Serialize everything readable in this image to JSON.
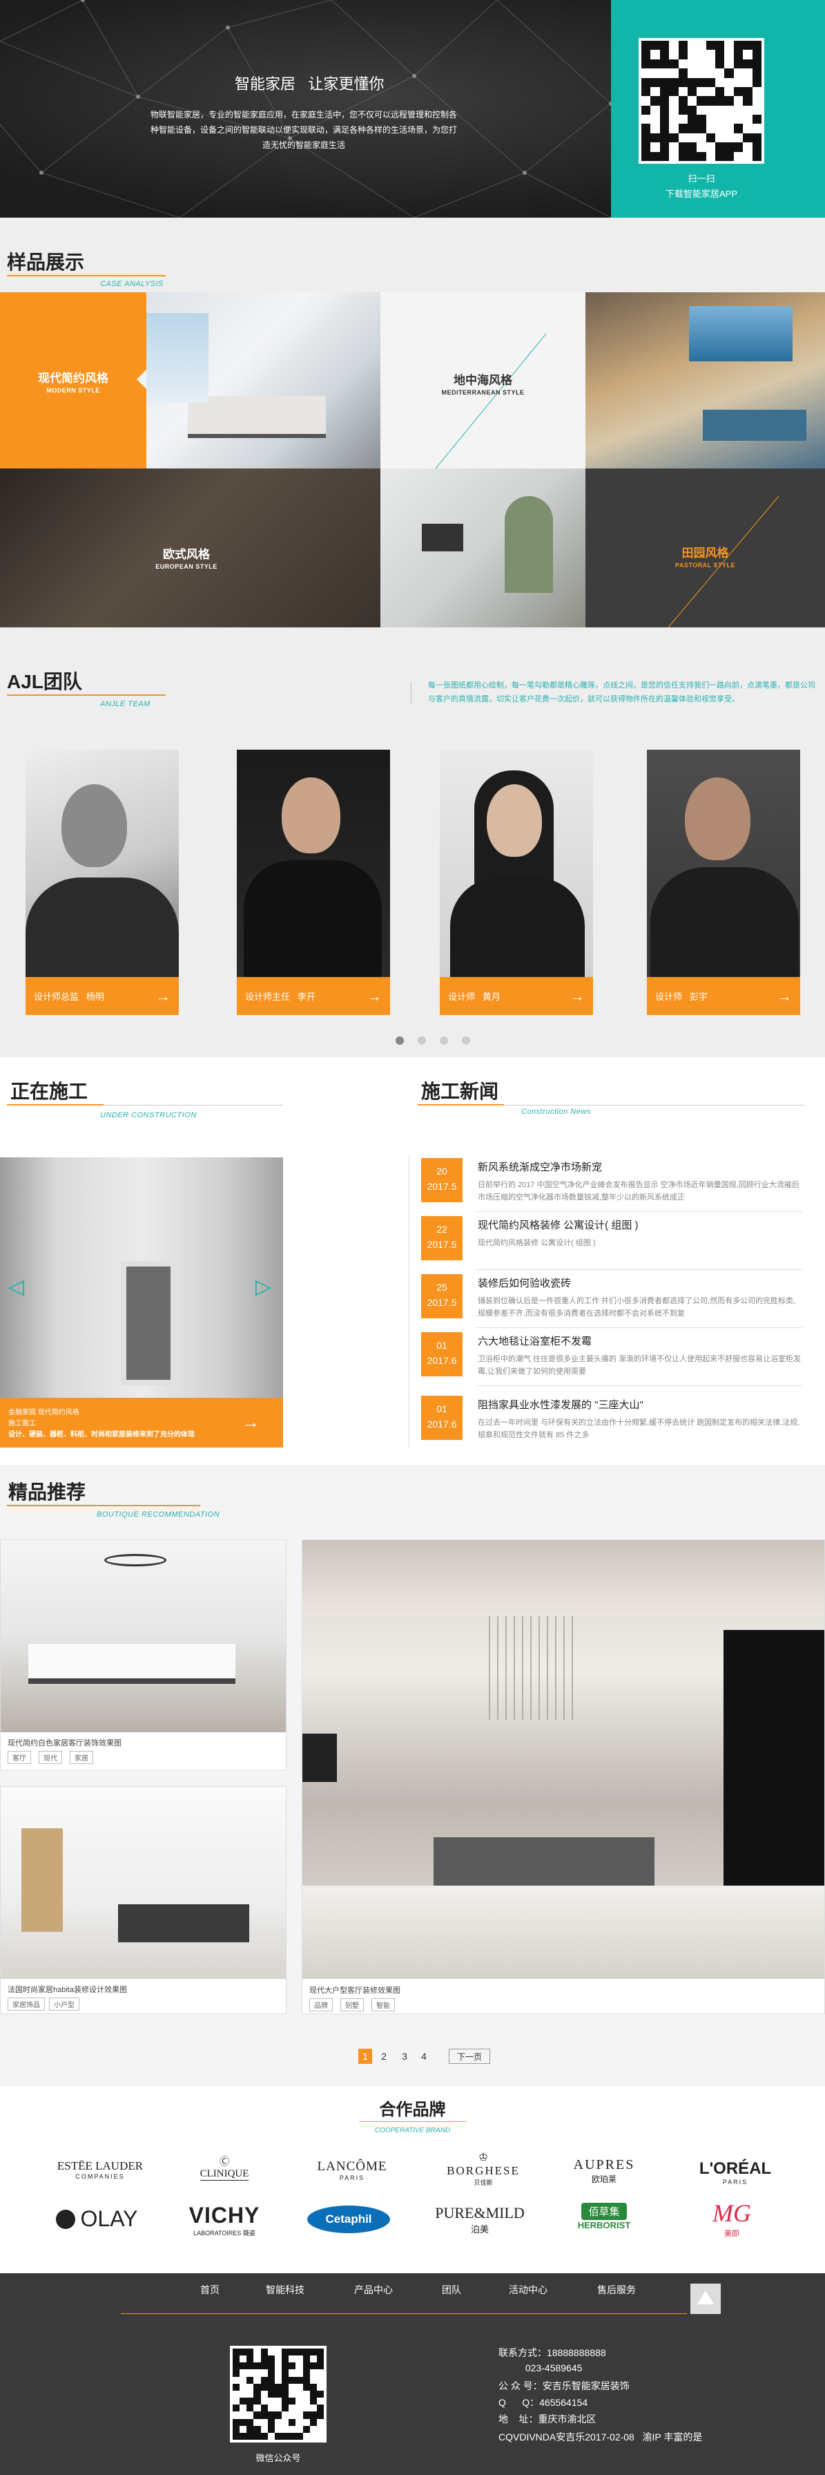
{
  "hero": {
    "title": "智能家居   让家更懂你",
    "desc": "物联智能家居，专业的智能家庭应用，在家庭生活中，您不仅可以远程管理和控制各种智能设备，设备之间的智能联动以便实现联动，满足各种各样的生活场景，为您打造无忧的智能家庭生活",
    "qr_caption1": "扫一扫",
    "qr_caption2": "下载智能家居APP"
  },
  "samples": {
    "title": "样品展示",
    "subtitle": "CASE ANALYSIS",
    "tiles": [
      {
        "cn": "现代简约风格",
        "en": "MODERN STYLE"
      },
      {
        "cn": "地中海风格",
        "en": "MEDITERRANEAN STYLE"
      },
      {
        "cn": "欧式风格",
        "en": "EUROPEAN STYLE"
      },
      {
        "cn": "田园风格",
        "en": "PASTORAL STYLE"
      }
    ]
  },
  "team": {
    "title": "AJL团队",
    "subtitle": "ANJLE TEAM",
    "intro": "每一张图纸都用心绘制，每一笔勾勒都是精心雕琢，点线之间，是您的信任支持我们一路向前，点滴笔墨，都是公司与客户的真情流露，切实让客户花费一次起价，就可以获得物件所在的温馨体验和视觉享受。",
    "members": [
      {
        "role": "设计师总监",
        "name": "杨明"
      },
      {
        "role": "设计师主任",
        "name": "李开"
      },
      {
        "role": "设计师",
        "name": "黄月"
      },
      {
        "role": "设计师",
        "name": "彭宇"
      }
    ]
  },
  "construction": {
    "title": "正在施工",
    "subtitle": "UNDER CONSTRUCTION",
    "caption1": "金融家园 现代简约风格",
    "caption2": "施工面工",
    "caption3": "设计、硬装、器柜、料柜、时尚和家居装修来到了充分的体现"
  },
  "news": {
    "title": "施工新闻",
    "subtitle": "Construction News",
    "items": [
      {
        "day": "20",
        "ym": "2017.5",
        "title": "新风系统渐成空净市场新宠",
        "desc": "日前举行的 2017 中国空气净化产业峰会发布报告显示 空净市场近年销量国规,回顾行业大流摧后 市场压缩的空气净化器市场数量锐减,整年少以的新风系统成正"
      },
      {
        "day": "22",
        "ym": "2017.5",
        "title": "现代简约风格装修 公寓设计( 组图 )",
        "desc": "现代简约风格装修 公寓设计( 组图 )"
      },
      {
        "day": "25",
        "ym": "2017.5",
        "title": "装修后如何验收瓷砖",
        "desc": "铺装到位确认后是一件很重人的工作 并们小很多消费者都选择了公司,然而有多公司的完胜标类,规模参差不齐,而没有很多消费者在选择时都不会对系统不到复"
      },
      {
        "day": "01",
        "ym": "2017.6",
        "title": "六大地毯让浴室柜不发霉",
        "desc": "卫浴柜中的潮气 往往是很多业主最头痛的 渐渐的环境不仅让人使用起来不舒服也容易让浴室柜发霉,让我们来做了如何的使用需要"
      },
      {
        "day": "01",
        "ym": "2017.6",
        "title": "阻挡家具业水性漆发展的 \"三座大山\"",
        "desc": "在过去一年时间里 与环保有关的立法由作十分频繁,缓不停去统计 跑国制定发布的相关法律,法规,规章和规范性文件就有 85 件之多"
      }
    ]
  },
  "boutique": {
    "title": "精品推荐",
    "subtitle": "BOUTIQUE RECOMMENDATION",
    "cards": [
      {
        "caption": "现代简约白色家居客厅装饰效果图",
        "tags": [
          "客厅",
          "现代",
          "家居"
        ]
      },
      {
        "caption": "法国时尚家居habita装修设计效果图",
        "tags": [
          "家居饰品",
          "小户型"
        ]
      },
      {
        "caption": "现代大户型客厅装修效果图",
        "tags": [
          "品牌",
          "别墅",
          "智能"
        ]
      }
    ],
    "pages": [
      "1",
      "2",
      "3",
      "4"
    ],
    "next": "下一页"
  },
  "partners": {
    "title": "合作品牌",
    "subtitle": "COOPERATIVE BRAND",
    "brands": [
      {
        "main": "ESTĒE LAUDER",
        "sub": "COMPANIES"
      },
      {
        "main": "CLINIQUE",
        "sub": ""
      },
      {
        "main": "LANCÔME",
        "sub": "PARIS"
      },
      {
        "main": "BORGHESE",
        "sub": "贝佳斯"
      },
      {
        "main": "AUPRES",
        "sub": "欧珀莱"
      },
      {
        "main": "L'ORÉAL",
        "sub": "PARIS"
      },
      {
        "main": "OLAY",
        "sub": ""
      },
      {
        "main": "VICHY",
        "sub": "LABORATOIRES 薇姿"
      },
      {
        "main": "Cetaphil",
        "sub": ""
      },
      {
        "main": "PURE&MILD",
        "sub": "泊美"
      },
      {
        "main": "佰草集",
        "sub": "HERBORIST"
      },
      {
        "main": "MG",
        "sub": "美即"
      }
    ]
  },
  "footer": {
    "nav": [
      "首页",
      "智能科技",
      "产品中心",
      "团队",
      "活动中心",
      "售后服务"
    ],
    "qr_caption": "微信公众号",
    "contact": [
      "联系方式：18888888888",
      "          023-4589645",
      "公 众 号：安吉乐智能家居装饰",
      "Q      Q：465564154",
      "地    址：重庆市渝北区",
      "CQVDIVNDA安吉乐2017-02-08   渝IP 丰富的是"
    ]
  },
  "colors": {
    "accent": "#f7931e",
    "teal": "#12b6a8",
    "dark": "#3a3a3a"
  }
}
